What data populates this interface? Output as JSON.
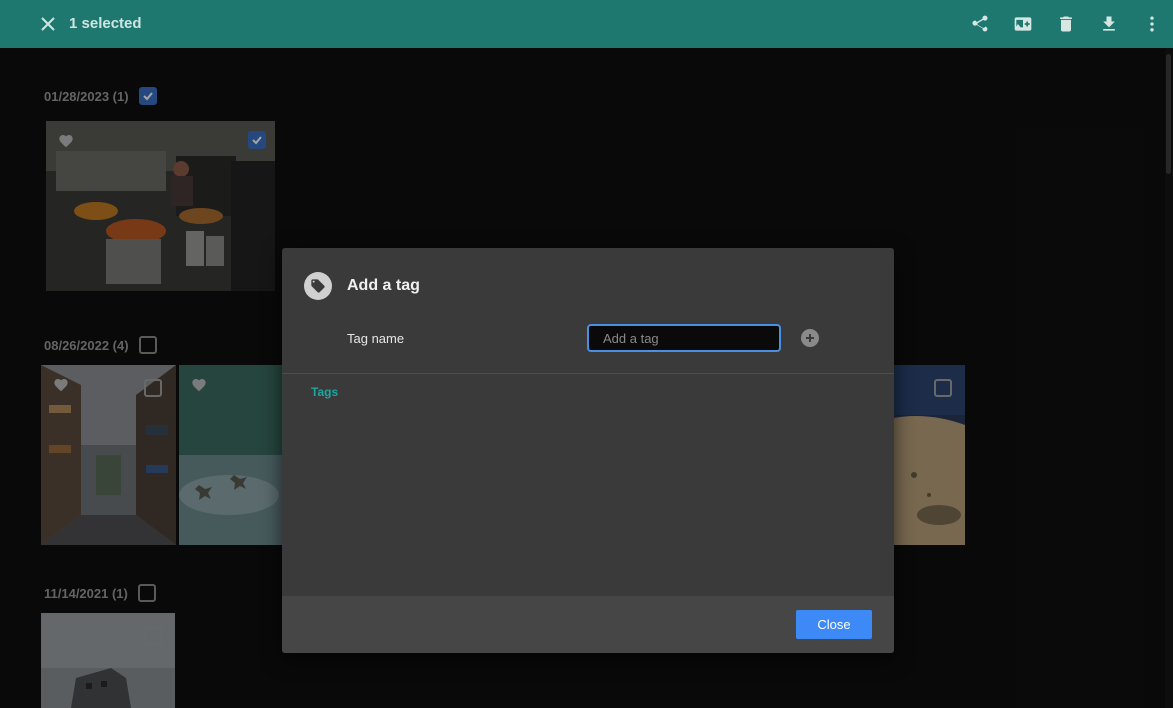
{
  "topbar": {
    "selected_text": "1 selected",
    "color": "#1f7870",
    "icons": [
      "close-icon",
      "share-icon",
      "add-to-album-icon",
      "delete-icon",
      "download-icon",
      "more-vert-icon"
    ]
  },
  "gallery": {
    "groups": [
      {
        "date": "01/28/2023 (1)",
        "checked": true
      },
      {
        "date": "08/26/2022 (4)",
        "checked": false
      },
      {
        "date": "11/14/2021 (1)",
        "checked": false
      }
    ]
  },
  "dialog": {
    "title": "Add a tag",
    "icon": "tag-icon",
    "field_label": "Tag name",
    "input_value": "",
    "input_placeholder": "Add a tag",
    "tags_section_label": "Tags",
    "close_label": "Close",
    "accent": "#3d8af7",
    "tags_color": "#1ea6a0"
  }
}
